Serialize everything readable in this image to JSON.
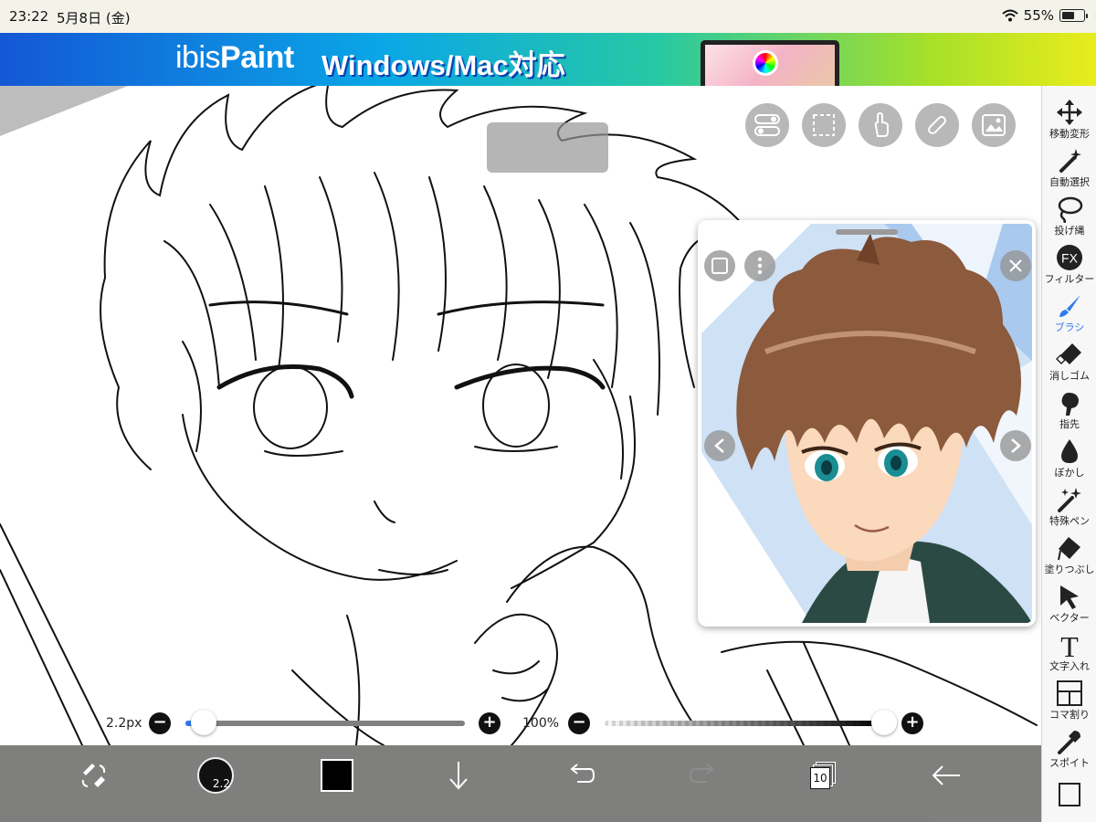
{
  "status_bar": {
    "time": "23:22",
    "date": "5月8日 (金)",
    "battery": "55%",
    "battery_level": 0.55
  },
  "banner": {
    "logo_prefix": "ibis",
    "logo_suffix": "Paint",
    "tagline": "Windows/Mac対応"
  },
  "right_toolbar": {
    "items": [
      {
        "label": "移動変形",
        "icon": "move-icon"
      },
      {
        "label": "自動選択",
        "icon": "magic-wand-icon"
      },
      {
        "label": "投げ縄",
        "icon": "lasso-icon"
      },
      {
        "label": "フィルター",
        "icon": "fx-filter-icon"
      },
      {
        "label": "ブラシ",
        "icon": "brush-icon",
        "active": true
      },
      {
        "label": "消しゴム",
        "icon": "eraser-icon"
      },
      {
        "label": "指先",
        "icon": "finger-icon"
      },
      {
        "label": "ぼかし",
        "icon": "blur-drop-icon"
      },
      {
        "label": "特殊ペン",
        "icon": "special-pen-icon"
      },
      {
        "label": "塗りつぶし",
        "icon": "fill-bucket-icon"
      },
      {
        "label": "ベクター",
        "icon": "vector-cursor-icon"
      },
      {
        "label": "文字入れ",
        "icon": "text-icon"
      },
      {
        "label": "コマ割り",
        "icon": "frame-divider-icon"
      },
      {
        "label": "スポイト",
        "icon": "eyedropper-icon"
      }
    ],
    "fx_text": "FX",
    "text_tool_glyph": "T"
  },
  "brush_controls": {
    "size_label": "2.2px",
    "size_value": 2.2,
    "opacity_label": "100%",
    "opacity_value": 100,
    "minus": "−",
    "plus": "+"
  },
  "bottom_bar": {
    "brush_size_badge": "2.2",
    "layer_count": "10",
    "current_color": "#000000"
  },
  "colors": {
    "accent": "#2f7bf0",
    "slider_fill": "#2f7bf0"
  }
}
